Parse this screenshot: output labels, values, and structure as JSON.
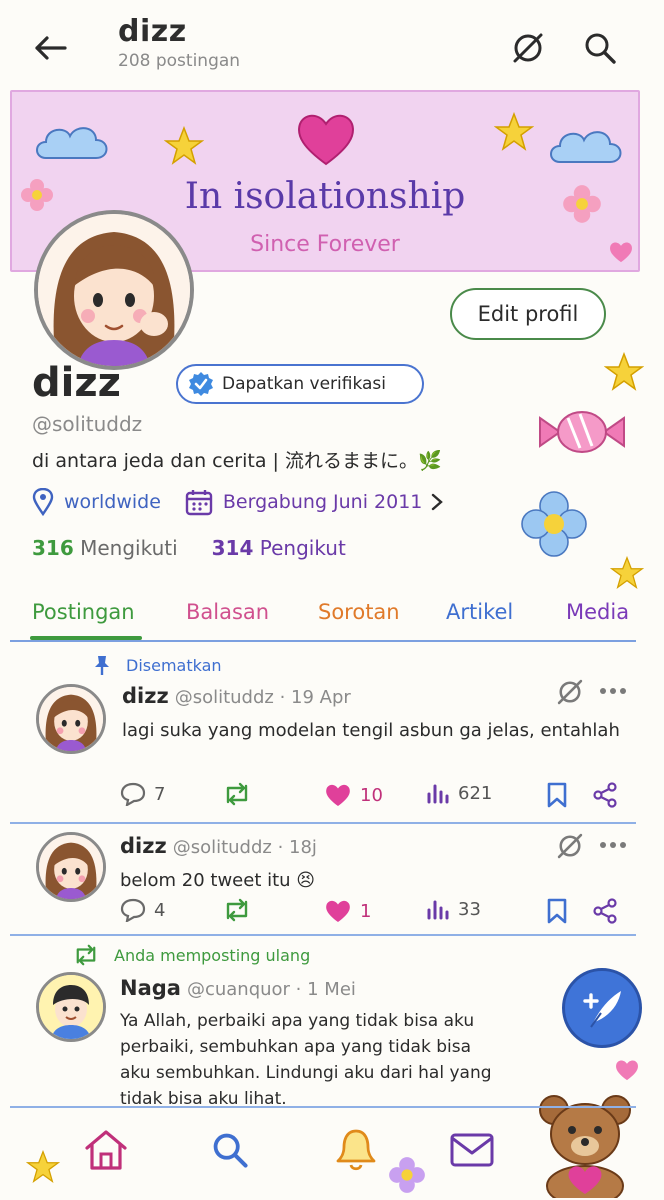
{
  "header": {
    "title": "dizz",
    "post_count": "208 postingan"
  },
  "banner": {
    "title": "In isolationship",
    "subtitle": "Since Forever"
  },
  "profile": {
    "edit_label": "Edit profil",
    "name": "dizz",
    "verify_label": "Dapatkan verifikasi",
    "handle": "@solituddz",
    "bio": "di antara jeda dan cerita | 流れるままに。🌿",
    "location": "worldwide",
    "joined": "Bergabung Juni 2011",
    "following_count": "316",
    "following_label": "Mengikuti",
    "followers_count": "314",
    "followers_label": "Pengikut"
  },
  "tabs": [
    {
      "label": "Postingan",
      "color": "#3e9a3e"
    },
    {
      "label": "Balasan",
      "color": "#d0508e"
    },
    {
      "label": "Sorotan",
      "color": "#e07a2a"
    },
    {
      "label": "Artikel",
      "color": "#3f6fd0"
    },
    {
      "label": "Media",
      "color": "#7a3ab8"
    }
  ],
  "posts": [
    {
      "pinned_label": "Disematkan",
      "name": "dizz",
      "meta": "@solituddz · 19 Apr",
      "text": "lagi suka yang modelan tengil asbun ga jelas, entahlah",
      "replies": "7",
      "likes": "10",
      "views": "621"
    },
    {
      "name": "dizz",
      "meta": "@solituddz · 18j",
      "text": "belom 20 tweet itu 😣",
      "replies": "4",
      "likes": "1",
      "views": "33"
    },
    {
      "repost_label": "Anda memposting ulang",
      "name": "Naga",
      "meta": "@cuanquor · 1 Mei",
      "text": "Ya Allah, perbaiki apa yang tidak bisa aku perbaiki, sembuhkan apa yang tidak bisa aku sembuhkan. Lindungi aku dari hal yang tidak bisa aku lihat."
    }
  ],
  "colors": {
    "green": "#3e9a3e",
    "blue": "#3f6fd0",
    "purple": "#6a3aa8",
    "pink": "#e0409a"
  },
  "icons": [
    "back-arrow-icon",
    "grok-icon",
    "search-icon",
    "location-pin-icon",
    "calendar-icon",
    "chevron-right-icon",
    "pin-icon",
    "reply-icon",
    "repost-icon",
    "heart-icon",
    "views-icon",
    "bookmark-icon",
    "share-icon",
    "more-icon",
    "compose-icon",
    "home-icon",
    "bell-icon",
    "mail-icon"
  ]
}
